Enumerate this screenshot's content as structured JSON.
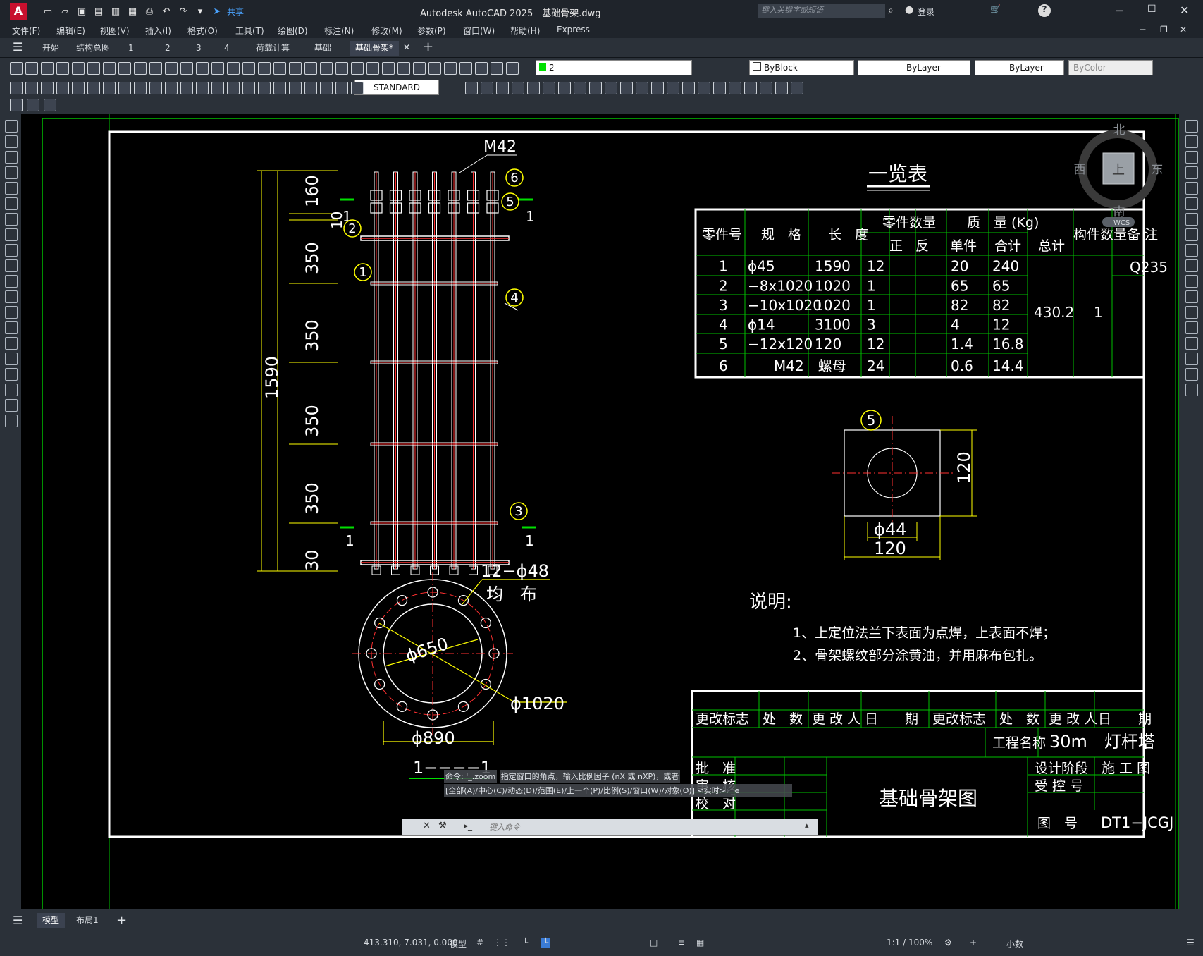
{
  "app": {
    "title": "Autodesk AutoCAD 2025",
    "file": "基础骨架.dwg",
    "search_placeholder": "键入关键字或短语",
    "login": "登录",
    "share": "共享"
  },
  "menu": [
    "文件(F)",
    "编辑(E)",
    "视图(V)",
    "插入(I)",
    "格式(O)",
    "工具(T)",
    "绘图(D)",
    "标注(N)",
    "修改(M)",
    "参数(P)",
    "窗口(W)",
    "帮助(H)",
    "Express"
  ],
  "tabs": [
    "开始",
    "结构总图",
    "1",
    "2",
    "3",
    "4",
    "荷载计算",
    "基础",
    "基础骨架*"
  ],
  "toolbar": {
    "layer": "2",
    "text_style": "STANDARD",
    "color": "ByBlock",
    "linetype": "ByLayer",
    "lineweight": "ByLayer",
    "plotstyle": "ByColor"
  },
  "viewcube": {
    "north": "北",
    "south": "南",
    "east": "东",
    "west": "西",
    "face": "上",
    "wcs": "WCS"
  },
  "drawing": {
    "elevation": {
      "bolt_label": "M42",
      "dims_left": [
        "160",
        "10",
        "350",
        "350",
        "350",
        "350",
        "30"
      ],
      "total": "1590",
      "section_mark": "1",
      "balloons": [
        "6",
        "5",
        "2",
        "1",
        "4",
        "3"
      ]
    },
    "plan": {
      "holes": "12−ϕ48",
      "even": "均　布",
      "d650": "ϕ650",
      "d1020": "ϕ1020",
      "d890": "ϕ890",
      "section_title": "1−−−−1"
    },
    "plate": {
      "balloon": "5",
      "d44": "ϕ44",
      "w": "120",
      "h": "120"
    },
    "table": {
      "title": "一览表",
      "headers": {
        "part_no": "零件号",
        "spec": "规　格",
        "length": "长　度",
        "qty": "零件数量",
        "qty_pos": "正",
        "qty_neg": "反",
        "mass": "质　量 (Kg)",
        "unit": "单件",
        "sum": "合计",
        "total": "总计",
        "member_qty": "构件数量",
        "note": "备 注"
      },
      "rows": [
        {
          "no": "1",
          "spec": "ϕ45",
          "len": "1590",
          "qty": "12",
          "unit": "20",
          "sum": "240"
        },
        {
          "no": "2",
          "spec": "−8x1020",
          "len": "1020",
          "qty": "1",
          "unit": "65",
          "sum": "65"
        },
        {
          "no": "3",
          "spec": "−10x1020",
          "len": "1020",
          "qty": "1",
          "unit": "82",
          "sum": "82"
        },
        {
          "no": "4",
          "spec": "ϕ14",
          "len": "3100",
          "qty": "3",
          "unit": "4",
          "sum": "12"
        },
        {
          "no": "5",
          "spec": "−12x120",
          "len": "120",
          "qty": "12",
          "unit": "1.4",
          "sum": "16.8"
        },
        {
          "no": "6",
          "spec": "M42　螺母",
          "len": "",
          "qty": "24",
          "unit": "0.6",
          "sum": "14.4"
        }
      ],
      "total": "430.2",
      "member_qty": "1",
      "note": "Q235"
    },
    "notes": {
      "title": "说明:",
      "line1": "1、上定位法兰下表面为点焊，上表面不焊；",
      "line2": "2、骨架螺纹部分涂黄油，并用麻布包扎。"
    },
    "titleblock": {
      "rev_headers": [
        "更改标志",
        "处　数",
        "更 改 人",
        "日　　期",
        "更改标志",
        "处　数",
        "更 改 人",
        "日　　期"
      ],
      "project_label": "工程名称",
      "project": "30m　灯杆塔",
      "approve": "批　准",
      "review": "审　核",
      "check": "校　对",
      "drawing_name": "基础骨架图",
      "stage_label": "设计阶段",
      "stage": "施 工 图",
      "control_label": "受 控 号",
      "number_label": "图　号",
      "number": "DT1−JCGJ"
    }
  },
  "command": {
    "history": [
      "命令: '_.zoom",
      "指定窗口的角点，输入比例因子 (nX 或 nXP)，或者",
      "[全部(A)/中心(C)/动态(D)/范围(E)/上一个(P)/比例(S)/窗口(W)/对象(O)] <实时>: _e"
    ],
    "placeholder": "键入命令"
  },
  "layout_tabs": [
    "模型",
    "布局1"
  ],
  "status": {
    "coords": "413.310, 7.031, 0.000",
    "model": "模型",
    "scale": "1:1 / 100%",
    "units": "小数"
  }
}
